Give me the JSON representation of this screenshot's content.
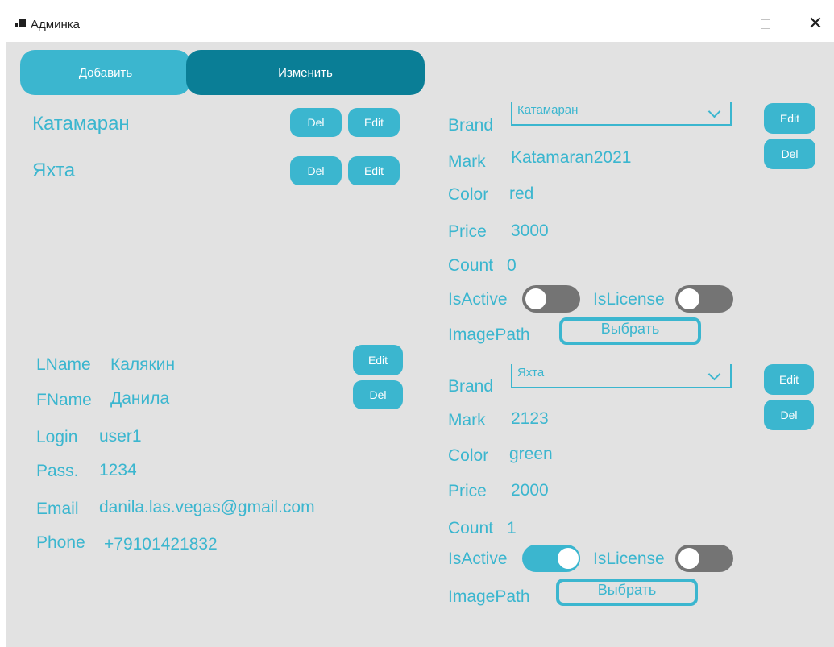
{
  "window": {
    "title": "Админка"
  },
  "tabs": {
    "add": "Добавить",
    "edit": "Изменить"
  },
  "items": [
    {
      "name": "Катамаран",
      "del": "Del",
      "edit": "Edit"
    },
    {
      "name": "Яхта",
      "del": "Del",
      "edit": "Edit"
    }
  ],
  "user": {
    "lname_label": "LName",
    "lname": "Калякин",
    "fname_label": "FName",
    "fname": "Данила",
    "login_label": "Login",
    "login": "user1",
    "pass_label": "Pass.",
    "pass": "1234",
    "email_label": "Email",
    "email": "danila.las.vegas@gmail.com",
    "phone_label": "Phone",
    "phone": "+79101421832",
    "edit": "Edit",
    "del": "Del"
  },
  "labels": {
    "brand": "Brand",
    "mark": "Mark",
    "color": "Color",
    "price": "Price",
    "count": "Count",
    "isactive": "IsActive",
    "islicense": "IsLicense",
    "imagepath": "ImagePath"
  },
  "products": [
    {
      "brand": "Катамаран",
      "mark": "Katamaran2021",
      "color": "red",
      "price": "3000",
      "count": "0",
      "is_active": false,
      "is_license": false,
      "pick": "Выбрать",
      "edit": "Edit",
      "del": "Del"
    },
    {
      "brand": "Яхта",
      "mark": "2123",
      "color": "green",
      "price": "2000",
      "count": "1",
      "is_active": true,
      "is_license": false,
      "pick": "Выбрать",
      "edit": "Edit",
      "del": "Del"
    }
  ],
  "colors": {
    "accent": "#3bb6cf",
    "accent_dark": "#0a7e96",
    "toggle_off": "#747474",
    "background": "#e2e2e2"
  }
}
